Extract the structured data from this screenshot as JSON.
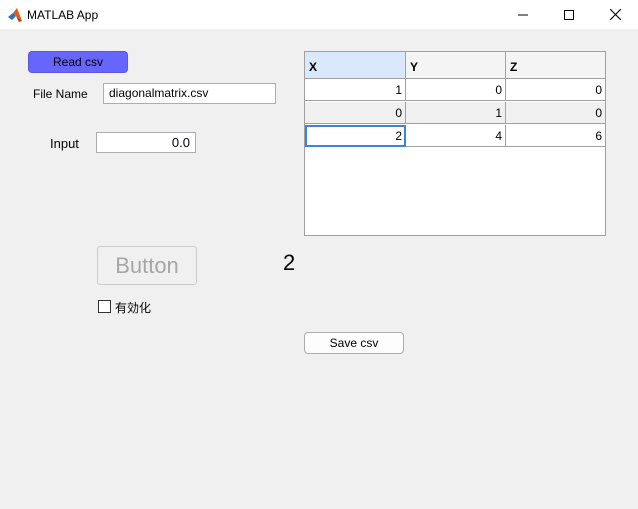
{
  "window": {
    "title": "MATLAB App"
  },
  "controls": {
    "read_button": "Read csv",
    "file_name_label": "File Name",
    "file_name_value": "diagonalmatrix.csv",
    "input_label": "Input",
    "input_value": "0.0",
    "big_button": "Button",
    "number_display": "2",
    "checkbox_label": "有効化",
    "checkbox_checked": false,
    "save_button": "Save csv"
  },
  "table": {
    "columns": [
      "X",
      "Y",
      "Z"
    ],
    "rows": [
      [
        "1",
        "0",
        "0"
      ],
      [
        "0",
        "1",
        "0"
      ],
      [
        "2",
        "4",
        "6"
      ]
    ]
  },
  "colors": {
    "read_button_bg": "#6666ff",
    "selection": "#3c84d6"
  }
}
